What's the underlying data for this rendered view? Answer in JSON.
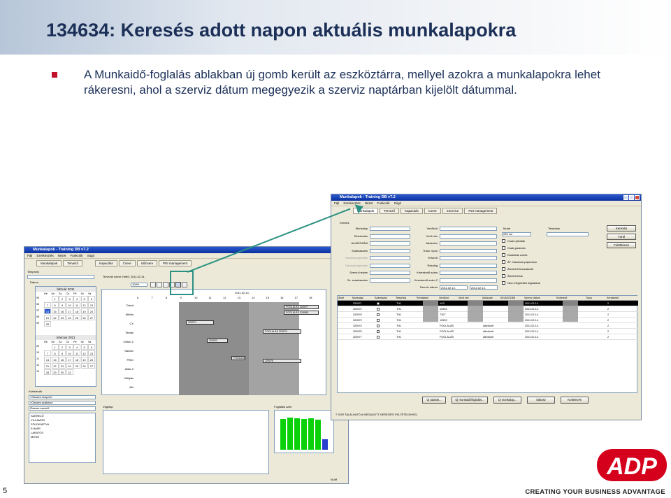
{
  "slide": {
    "title": "134634: Keresés adott napon aktuális munkalapokra",
    "bullet": "A Munkaidő-foglalás ablakban új gomb került az eszköztárra, mellyel azokra a munkalapokra lehet rákeresni, ahol a szerviz dátum megegyezik a szerviz naptárban kijelölt dátummal.",
    "page_number": "5",
    "tagline": "CREATING YOUR BUSINESS ADVANTAGE",
    "logo_text": "ADP"
  },
  "colors": {
    "title": "#1b2f57",
    "bullet": "#c0102a",
    "accent": "#2b9180",
    "logo": "#d5001c"
  },
  "left_window": {
    "title": "Munkalapok - Training DB v7.2",
    "menu": [
      "Fájl",
      "Szerkesztés",
      "Nézet",
      "Funkciók",
      "Súgó"
    ],
    "tabs": [
      "Munkalapok",
      "Tervező",
      "Kapacitás",
      "Csere",
      "Időcsere",
      "PDI management"
    ],
    "toolbar_info": "Tervezői nézet: Hétfő, 2011.02.14.",
    "zoom": "100%",
    "site_label": "Telephely",
    "date_label": "Dátum",
    "month1": "február 2011",
    "month2": "március 2011",
    "weekdays": [
      "Hé",
      "Ke",
      "Sz",
      "Cs",
      "Pé",
      "Sz",
      "Va"
    ],
    "date_header": "2011.02.14.",
    "hours": [
      "6",
      "7",
      "8",
      "9",
      "10",
      "11",
      "12",
      "13",
      "14",
      "15",
      "16",
      "17",
      "18"
    ],
    "mechanics": [
      "Dávid",
      "Miklós",
      "CX",
      "Tamás",
      "Zoltán 2",
      "Sándor",
      "Péter",
      "Attila 2",
      "Mátyás",
      "AM"
    ],
    "bars": [
      "FOGLALÁS 320577",
      "FOGLALÁS 319999",
      "320571",
      "FOGLALÁS 320574",
      "320522",
      "FOGLALÁS 320576",
      "320578"
    ],
    "mechanic_label": "Kivitelezők",
    "filter1": "<Összes csoport>",
    "filter2": "<Összes szakma>",
    "filter3": "Összes szerelő",
    "people": [
      "SZERELŐ",
      "VILLAMOS",
      "ZÖLDKÁRTYA",
      "ELMAR",
      "LAKATOS",
      "MOSÓ"
    ],
    "note_label": "Vágólap",
    "chart_label": "Foglalási szint",
    "status": "NUM"
  },
  "right_window": {
    "title": "Munkalapok - Training DB v7.2",
    "menu": [
      "Fájl",
      "Szerkesztés",
      "Nézet",
      "Funkciók",
      "Súgó"
    ],
    "tabs": [
      "Munkalapok",
      "Tervező",
      "Kapacitás",
      "Csere",
      "eService",
      "PDI management"
    ],
    "filter_title": "Kérelés",
    "left_labels": [
      "Munkalap",
      "Rendszám",
      "ALVÁZSZÁM",
      "Számlaszám",
      "Garancia igénylés",
      "Garancia igénylés",
      "Szerviz helyes",
      "Sz. számlaszám"
    ],
    "mid_labels": [
      "Vevőkód",
      "Vevő név",
      "Adószám",
      "Tranz. típus",
      "Felvevő",
      "Részleg",
      "Kereskedő szám",
      "Kereskedő szám 2",
      "Szerviz dátum"
    ],
    "date_from": "2011.02.14.",
    "date_to": "2011.02.14.",
    "count_label": "Mutat",
    "count_value": "250 sor",
    "site_label": "Telephely",
    "checks": [
      "Csak nyitottak",
      "Csak garancia",
      "Kiadottak címek",
      "ÁT. Garancia papírokon",
      "Átvehető tranzakciók",
      "Átvehető kis",
      "Nem elégítettek leglalások"
    ],
    "side_buttons": [
      "Keresés",
      "Töröl",
      "Feltöltések"
    ],
    "columns": [
      "Átvét",
      "Munkalap",
      "Számlázás",
      "Telephely",
      "Rendszám",
      "Vevőkód",
      "Vevő név",
      "Adószám",
      "ALVÁZSZÁM",
      "Szerviz dátum",
      "Kivitelező",
      "Típus",
      "Kereskedő"
    ],
    "rows": [
      [
        "320571",
        "TH1",
        "X03",
        "",
        "2011.02.14.",
        "2"
      ],
      [
        "320572",
        "TH1",
        "15304",
        "",
        "2011.02.14.",
        "2"
      ],
      [
        "320576",
        "TH1",
        "7307",
        "",
        "2011.02.14.",
        "2"
      ],
      [
        "320573",
        "TH1",
        "10503",
        "",
        "2011.02.14.",
        "2"
      ],
      [
        "320574",
        "TH1",
        "FOGLALÁS",
        "Alledlozlt",
        "2011.02.14.",
        "2"
      ],
      [
        "320575",
        "TH1",
        "FOGLALÁS",
        "Alledlozlt",
        "2011.02.14.",
        "2"
      ],
      [
        "320577",
        "TH1",
        "FOGLALÁS",
        "Alledlozlt",
        "2011.02.14.",
        "2"
      ]
    ],
    "bottom_buttons": [
      "Új adatok...",
      "Új munkaidőfoglalás...",
      "Új munkalap...",
      "Státusz",
      "Kivitelezés"
    ],
    "status": "7 SOR TALÁLHATÓ A MEGADOTT KERESÉSI FELTÉTELEKKEL"
  },
  "level_chart": {
    "values": [
      0.88,
      0.92,
      0.9,
      0.88,
      0.9,
      0.86,
      0.3
    ]
  }
}
